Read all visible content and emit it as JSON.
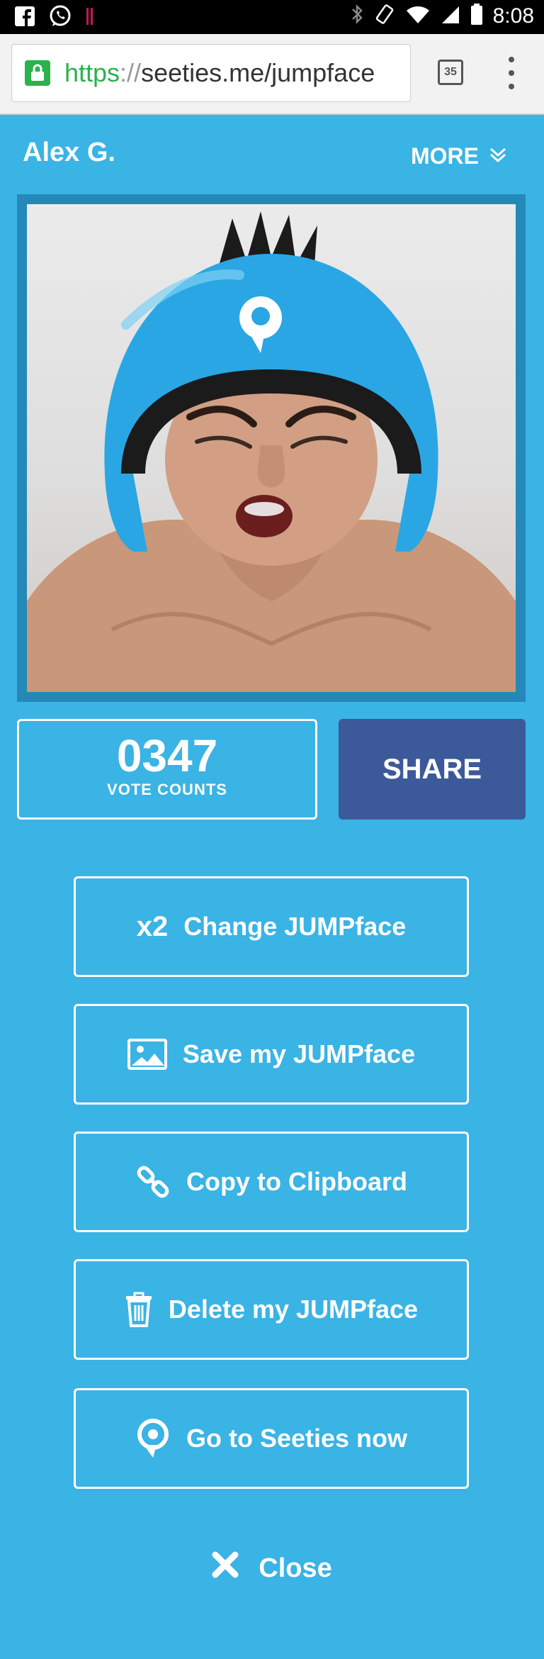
{
  "status_bar": {
    "time": "8:08",
    "left_icons": [
      "facebook-icon",
      "whatsapp-icon",
      "notification-icon"
    ],
    "right_icons": [
      "bluetooth-icon",
      "rotate-icon",
      "wifi-icon",
      "signal-icon",
      "battery-icon"
    ]
  },
  "browser": {
    "url_scheme": "https",
    "url_sep": "://",
    "url_host": "seeties.me/jumpface",
    "tab_count": "35"
  },
  "header": {
    "user_name": "Alex G.",
    "more_label": "MORE"
  },
  "stats": {
    "vote_count": "0347",
    "vote_label": "VOTE COUNTS",
    "share_label": "SHARE"
  },
  "actions": {
    "change_multiplier": "x2",
    "change_label": "Change JUMPface",
    "save_label": "Save my JUMPface",
    "copy_label": "Copy to Clipboard",
    "delete_label": "Delete my JUMPface",
    "goto_label": "Go to Seeties now"
  },
  "footer": {
    "close_label": "Close"
  },
  "colors": {
    "background": "#3ab3e5",
    "frame": "#2489b8",
    "share": "#3c5a9a",
    "lock_green": "#2bb24c"
  }
}
